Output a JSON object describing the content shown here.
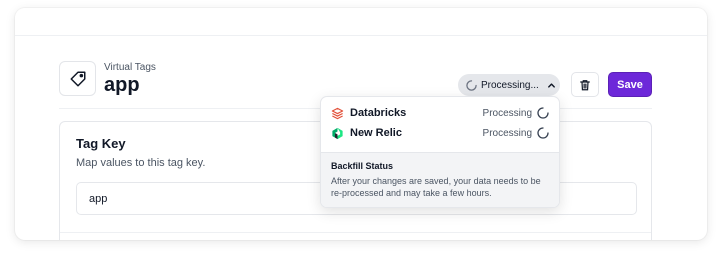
{
  "header": {
    "eyebrow": "Virtual Tags",
    "title": "app",
    "status_label": "Processing...",
    "save_label": "Save"
  },
  "tag_key": {
    "title": "Tag Key",
    "description": "Map values to this tag key.",
    "value": "app"
  },
  "dropdown": {
    "items": [
      {
        "name": "Databricks",
        "status": "Processing",
        "icon": "databricks-icon",
        "color": "#e2513a"
      },
      {
        "name": "New Relic",
        "status": "Processing",
        "icon": "new-relic-icon",
        "color": "#1ce783"
      }
    ],
    "footer_title": "Backfill Status",
    "footer_body": "After your changes are saved, your data needs to be re-processed and may take a few hours."
  },
  "colors": {
    "accent": "#6d28d9",
    "pill_bg": "#e5e7eb"
  }
}
